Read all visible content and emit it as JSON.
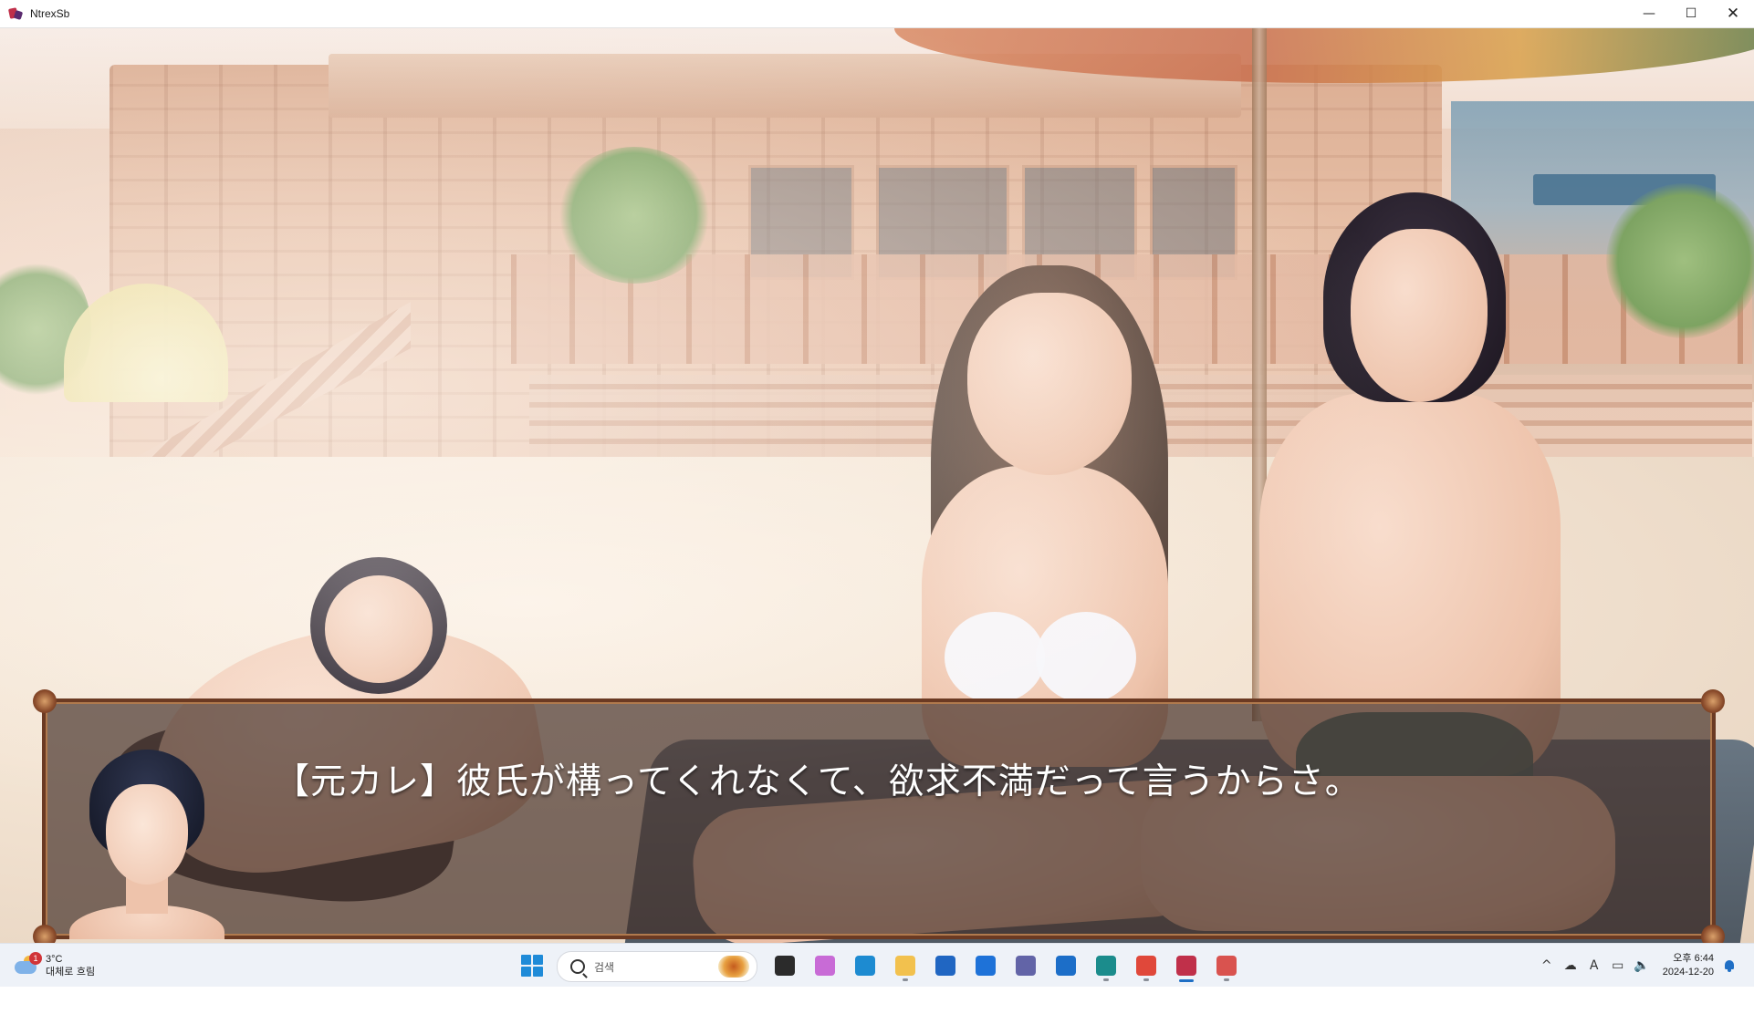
{
  "window": {
    "title": "NtrexSb",
    "controls": {
      "minimize": "—",
      "maximize": "☐",
      "close": "✕"
    }
  },
  "dialogue": {
    "text": "【元カレ】彼氏が構ってくれなくて、欲求不満だって言うからさ。"
  },
  "taskbar": {
    "weather": {
      "badge": "1",
      "temperature": "3°C",
      "description": "대체로 흐림"
    },
    "search": {
      "placeholder": "검색"
    },
    "apps": [
      {
        "name": "task-view-icon",
        "color": "#2b2b2b",
        "state": ""
      },
      {
        "name": "copilot-icon",
        "color": "#c86bd6",
        "state": ""
      },
      {
        "name": "edge-icon",
        "color": "#1d8bd1",
        "state": ""
      },
      {
        "name": "file-explorer-icon",
        "color": "#f2c14e",
        "state": "running"
      },
      {
        "name": "store-icon",
        "color": "#2066c2",
        "state": ""
      },
      {
        "name": "app-arrow-icon",
        "color": "#1e72d8",
        "state": ""
      },
      {
        "name": "teams-icon",
        "color": "#6264a7",
        "state": ""
      },
      {
        "name": "mail-icon",
        "color": "#1c6ec8",
        "state": ""
      },
      {
        "name": "app-s-icon",
        "color": "#1b8c8c",
        "state": "running"
      },
      {
        "name": "chrome-icon",
        "color": "#e0483a",
        "state": "running"
      },
      {
        "name": "ntrexsb-icon",
        "color": "#c0304a",
        "state": "active"
      },
      {
        "name": "snip-icon",
        "color": "#d9534f",
        "state": "running"
      }
    ],
    "tray": {
      "overflow": "^",
      "onedrive": "☁",
      "ime": "A",
      "network": "▭",
      "volume": "🔈"
    },
    "clock": {
      "time": "오후 6:44",
      "date": "2024-12-20"
    }
  }
}
